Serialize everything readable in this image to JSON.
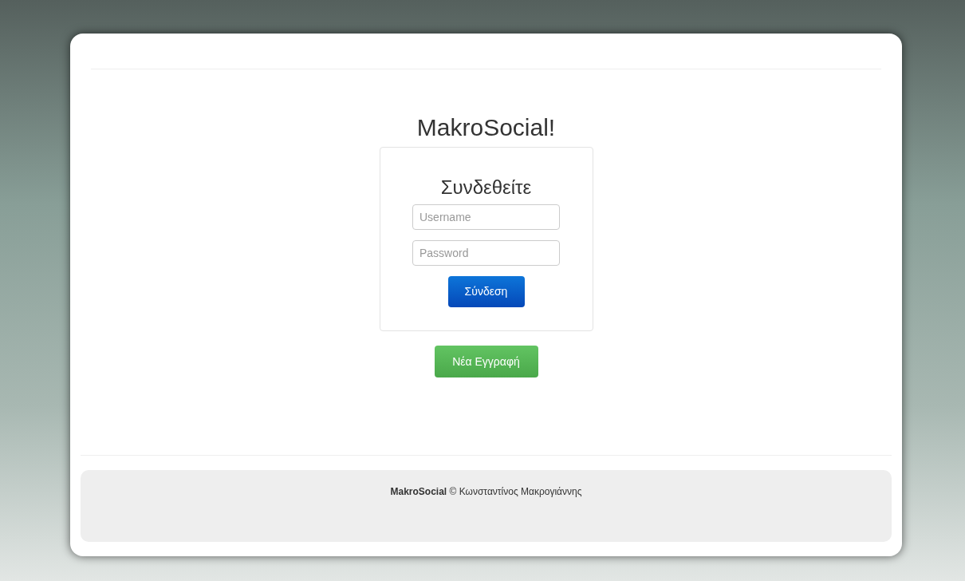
{
  "site_title": "MakroSocial!",
  "login": {
    "heading": "Συνδεθείτε",
    "username": {
      "placeholder": "Username"
    },
    "password": {
      "placeholder": "Password"
    },
    "submit": "Σύνδεση"
  },
  "register_button": "Νέα Εγγραφή",
  "footer": "**MakroSocial** © Κωνσταντίνος Μακρογιάννης"
}
